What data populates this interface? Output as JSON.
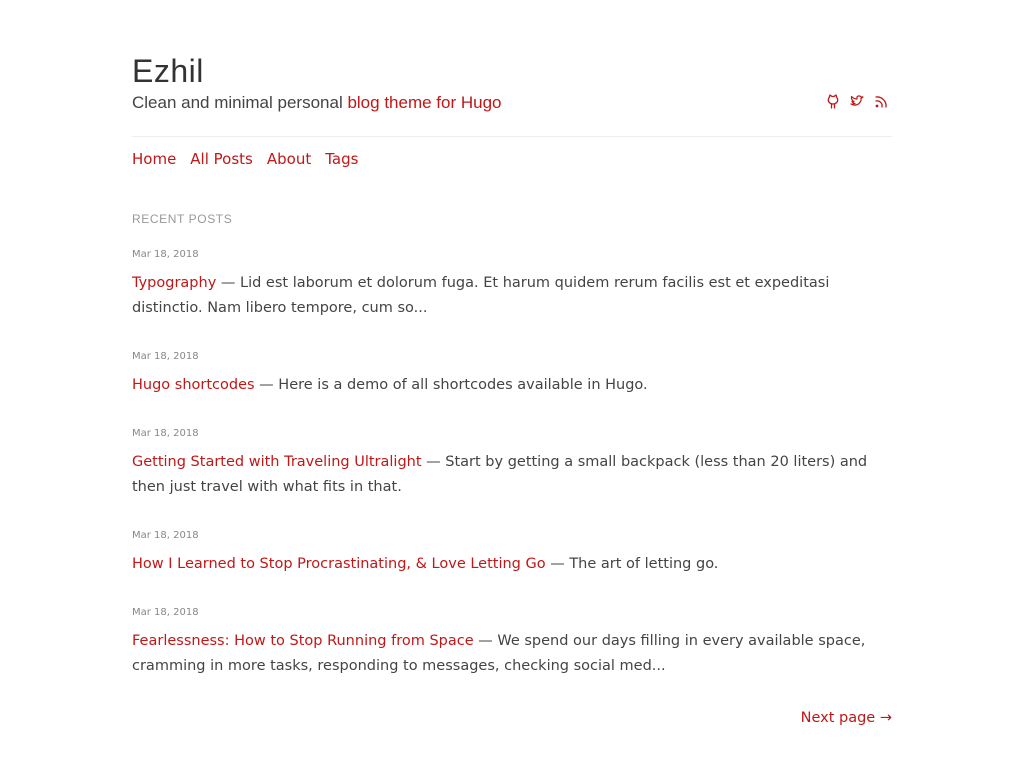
{
  "site": {
    "title": "Ezhil",
    "tagline_plain": "Clean and minimal personal ",
    "tagline_accent": "blog theme for Hugo",
    "accent_color": "#c11717"
  },
  "social": [
    {
      "icon": "github-icon"
    },
    {
      "icon": "twitter-icon"
    },
    {
      "icon": "rss-icon"
    }
  ],
  "nav": {
    "items": [
      {
        "label": "Home"
      },
      {
        "label": "All Posts"
      },
      {
        "label": "About"
      },
      {
        "label": "Tags"
      }
    ]
  },
  "section": {
    "title": "RECENT POSTS"
  },
  "posts": [
    {
      "date": "Mar 18, 2018",
      "title": "Typography",
      "separator": " — ",
      "summary": "Lid est laborum et dolorum fuga. Et harum quidem rerum facilis est et expeditasi distinctio. Nam libero tempore, cum so..."
    },
    {
      "date": "Mar 18, 2018",
      "title": "Hugo shortcodes",
      "separator": " — ",
      "summary": "Here is a demo of all shortcodes available in Hugo."
    },
    {
      "date": "Mar 18, 2018",
      "title": "Getting Started with Traveling Ultralight",
      "separator": " — ",
      "summary": "Start by getting a small backpack (less than 20 liters) and then just travel with what fits in that."
    },
    {
      "date": "Mar 18, 2018",
      "title": "How I Learned to Stop Procrastinating, & Love Letting Go",
      "separator": " — ",
      "summary": "The art of letting go."
    },
    {
      "date": "Mar 18, 2018",
      "title": "Fearlessness: How to Stop Running from Space",
      "separator": " — ",
      "summary": "We spend our days filling in every available space, cramming in more tasks, responding to messages, checking social med..."
    }
  ],
  "pagination": {
    "next_label": "Next page →"
  }
}
